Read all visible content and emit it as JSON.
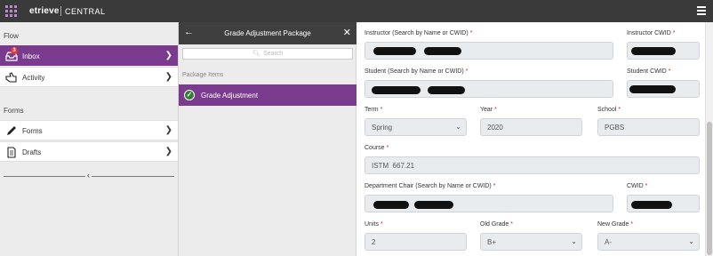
{
  "topbar": {
    "brand": "etrieve",
    "product": "CENTRAL",
    "apps_icon": "grid-icon",
    "menu_icon": "hamburger-icon"
  },
  "leftnav": {
    "flow_label": "Flow",
    "flow_items": [
      {
        "label": "Inbox",
        "icon": "inbox-icon",
        "badge": "3",
        "active": true
      },
      {
        "label": "Activity",
        "icon": "hand-pointer-icon",
        "active": false
      }
    ],
    "forms_label": "Forms",
    "forms_items": [
      {
        "label": "Forms",
        "icon": "pencil-icon"
      },
      {
        "label": "Drafts",
        "icon": "document-icon"
      }
    ]
  },
  "package": {
    "title": "Grade Adjustment Package",
    "search_placeholder": "Search",
    "items_label": "Package Items",
    "items": [
      {
        "label": "Grade Adjustment",
        "status": "complete"
      }
    ]
  },
  "form": {
    "instructor_label": "Instructor (Search by Name or CWID)",
    "instructor_cwid_label": "Instructor CWID",
    "student_label": "Student (Search by Name or CWID)",
    "student_cwid_label": "Student CWID",
    "term_label": "Term",
    "term_value": "Spring",
    "year_label": "Year",
    "year_value": "2020",
    "school_label": "School",
    "school_value": "PGBS",
    "course_label": "Course",
    "course_value": "ISTM  667.21",
    "dept_chair_label": "Department Chair (Search by Name or CWID)",
    "cwid_label": "CWID",
    "units_label": "Units",
    "units_value": "2",
    "old_grade_label": "Old Grade",
    "old_grade_value": "B+",
    "new_grade_label": "New Grade",
    "new_grade_value": "A-",
    "required_mark": "*"
  },
  "colors": {
    "accent": "#7a3b8f",
    "topbar": "#3a3a3a",
    "required": "#c62828",
    "success": "#2e7d32"
  }
}
